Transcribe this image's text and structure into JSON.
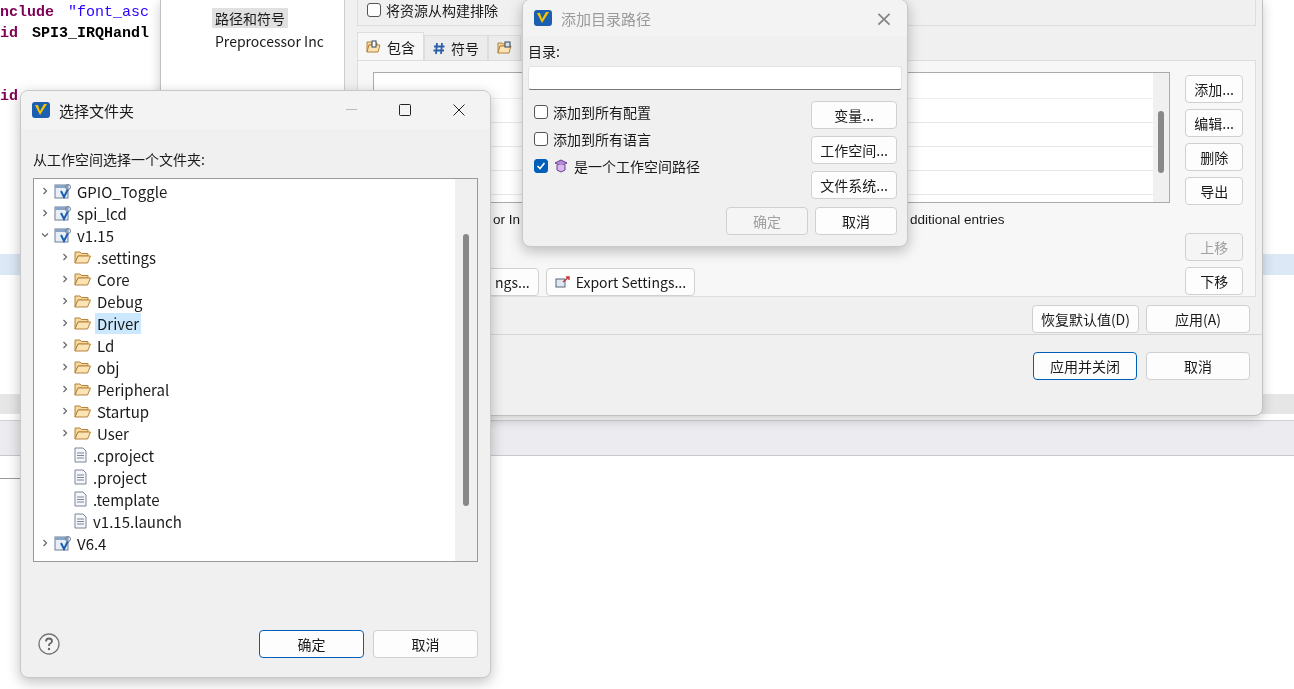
{
  "editor": {
    "lines": [
      {
        "kind": "code",
        "highlighted": false,
        "tokens": [
          {
            "kind": "keyword",
            "text": "nclude"
          },
          {
            "kind": "string",
            "text": "\"font_asc"
          }
        ]
      },
      {
        "kind": "code",
        "highlighted": false,
        "tokens": [
          {
            "kind": "keyword",
            "text": "id"
          },
          {
            "kind": "ident",
            "text": "SPI3_IRQHandl"
          }
        ]
      },
      {
        "kind": "blank",
        "highlighted": false
      },
      {
        "kind": "blank",
        "highlighted": false
      },
      {
        "kind": "code",
        "highlighted": false,
        "tokens": [
          {
            "kind": "keyword",
            "text": "id"
          }
        ]
      },
      {
        "kind": "blank",
        "highlighted": false
      },
      {
        "kind": "blank",
        "highlighted": false
      },
      {
        "kind": "blank",
        "highlighted": false
      },
      {
        "kind": "blank",
        "highlighted": false
      },
      {
        "kind": "blank",
        "highlighted": false
      },
      {
        "kind": "blank",
        "highlighted": false
      },
      {
        "kind": "blank",
        "highlighted": false
      },
      {
        "kind": "blank",
        "highlighted": true
      }
    ]
  },
  "properties_dialog": {
    "nav": [
      {
        "label": "路径和符号",
        "selected": true
      },
      {
        "label": "Preprocessor Inc",
        "selected": false
      }
    ],
    "exclude_checkbox": {
      "label": "将资源从构建排除",
      "checked": false
    },
    "tabs": [
      {
        "kind": "include",
        "label": "包含",
        "selected": true
      },
      {
        "kind": "symbol",
        "label": "符号",
        "selected": false
      },
      {
        "kind": "library",
        "selected": false
      }
    ],
    "note_fragments": [
      "or In",
      "dditional entries"
    ],
    "settings_buttons": [
      {
        "kind": "plain",
        "label": "ngs..."
      },
      {
        "kind": "export",
        "label": "Export Settings..."
      }
    ],
    "side_buttons": [
      {
        "label": "添加...",
        "disabled": false
      },
      {
        "label": "编辑...",
        "disabled": false
      },
      {
        "label": "删除",
        "disabled": false
      },
      {
        "label": "导出",
        "disabled": false
      },
      {
        "label": "上移",
        "disabled": true
      },
      {
        "label": "下移",
        "disabled": false
      }
    ],
    "footer_buttons": [
      {
        "label": "恢复默认值(D)",
        "default": false
      },
      {
        "label": "应用(A)",
        "default": false
      }
    ],
    "dialog_buttons": [
      {
        "label": "应用并关闭",
        "default": true
      },
      {
        "label": "取消",
        "default": false
      }
    ]
  },
  "add_dialog": {
    "title": "添加目录路径",
    "active": false,
    "close": "×",
    "field_label": "目录:",
    "checkboxes": [
      {
        "label": "添加到所有配置",
        "checked": false,
        "kind": "plain"
      },
      {
        "label": "添加到所有语言",
        "checked": false,
        "kind": "plain"
      },
      {
        "label": "是一个工作空间路径",
        "checked": true,
        "kind": "workspace"
      }
    ],
    "side_buttons": [
      {
        "label": "变量..."
      },
      {
        "label": "工作空间..."
      },
      {
        "label": "文件系统..."
      }
    ],
    "buttons": [
      {
        "label": "确定",
        "disabled": true
      },
      {
        "label": "取消",
        "disabled": false
      }
    ]
  },
  "folder_dialog": {
    "title": "选择文件夹",
    "active": true,
    "prompt": "从工作空间选择一个文件夹:",
    "tree": [
      {
        "kind": "project",
        "label": "GPIO_Toggle",
        "expanded": false,
        "selected": false
      },
      {
        "kind": "project",
        "label": "spi_lcd",
        "expanded": false,
        "selected": false
      },
      {
        "kind": "project",
        "label": "v1.15",
        "expanded": true,
        "selected": false,
        "children": [
          {
            "kind": "folder",
            "label": ".settings",
            "expanded": false,
            "selected": false
          },
          {
            "kind": "folder",
            "label": "Core",
            "expanded": false,
            "selected": false
          },
          {
            "kind": "folder",
            "label": "Debug",
            "expanded": false,
            "selected": false
          },
          {
            "kind": "folder",
            "label": "Driver",
            "expanded": false,
            "selected": true
          },
          {
            "kind": "folder",
            "label": "Ld",
            "expanded": false,
            "selected": false
          },
          {
            "kind": "folder",
            "label": "obj",
            "expanded": false,
            "selected": false
          },
          {
            "kind": "folder",
            "label": "Peripheral",
            "expanded": false,
            "selected": false
          },
          {
            "kind": "folder",
            "label": "Startup",
            "expanded": false,
            "selected": false
          },
          {
            "kind": "folder",
            "label": "User",
            "expanded": false,
            "selected": false
          },
          {
            "kind": "file",
            "label": ".cproject",
            "selected": false
          },
          {
            "kind": "file",
            "label": ".project",
            "selected": false
          },
          {
            "kind": "file",
            "label": ".template",
            "selected": false
          },
          {
            "kind": "file",
            "label": "v1.15.launch",
            "selected": false
          }
        ]
      },
      {
        "kind": "project",
        "label": "V6.4",
        "expanded": false,
        "selected": false
      }
    ],
    "buttons": [
      {
        "label": "确定",
        "default": true
      },
      {
        "label": "取消",
        "default": false
      }
    ]
  }
}
